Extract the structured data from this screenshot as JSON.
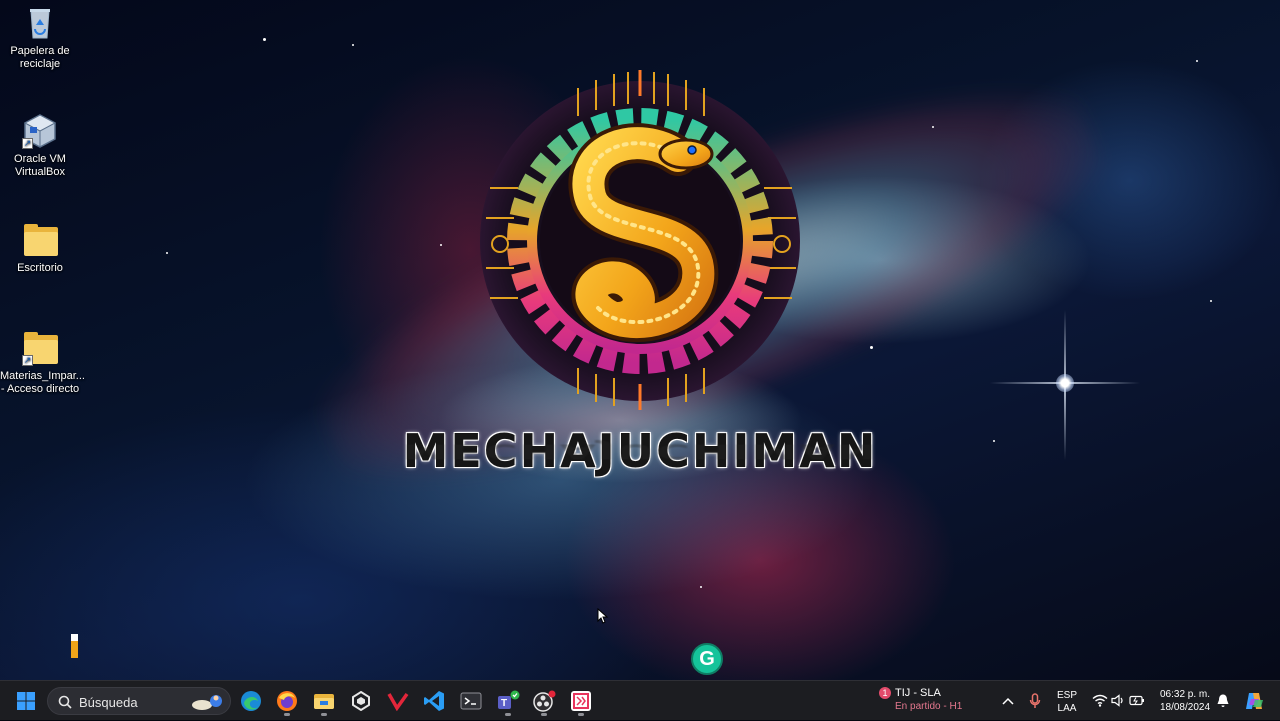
{
  "desktop": {
    "icons": [
      {
        "label_line1": "Papelera de",
        "label_line2": "reciclaje",
        "icon": "recycle-bin-icon"
      },
      {
        "label_line1": "Oracle VM",
        "label_line2": "VirtualBox",
        "icon": "virtualbox-icon"
      },
      {
        "label_line1": "Escritorio",
        "label_line2": "",
        "icon": "folder-icon"
      },
      {
        "label_line1": "Materias_Impar...",
        "label_line2": "- Acceso directo",
        "icon": "folder-shortcut-icon"
      }
    ],
    "wallpaper_title": "MECHAJUCHIMAN",
    "progress_level": 0.7,
    "grammarly_letter": "G"
  },
  "taskbar": {
    "search_placeholder": "Búsqueda",
    "apps": [
      "start-icon",
      "edge-icon",
      "firefox-icon",
      "file-explorer-icon",
      "unity-icon",
      "git-client-icon",
      "vscode-icon",
      "terminal-icon",
      "teams-icon",
      "obs-icon",
      "jetbrains-icon"
    ],
    "sport_widget": {
      "badge": "1",
      "title": "TIJ - SLA",
      "status": "En partido - H1"
    },
    "language": {
      "line1": "ESP",
      "line2": "LAA"
    },
    "clock": {
      "time": "06:32 p. m.",
      "date": "18/08/2024"
    },
    "accent": "#0078d4"
  }
}
